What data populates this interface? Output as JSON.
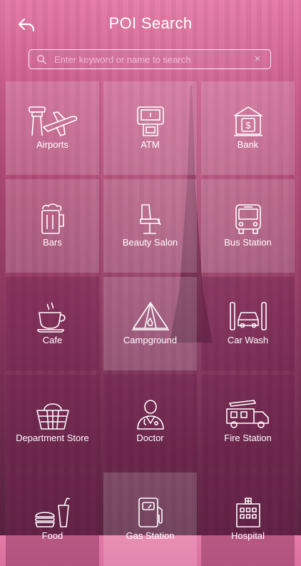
{
  "header": {
    "title": "POI Search",
    "back_icon": "back-arrow-icon"
  },
  "search": {
    "placeholder": "Enter keyword or name to search",
    "value": ""
  },
  "categories": [
    {
      "label": "Airports",
      "icon": "airport-icon"
    },
    {
      "label": "ATM",
      "icon": "atm-icon"
    },
    {
      "label": "Bank",
      "icon": "bank-icon"
    },
    {
      "label": "Bars",
      "icon": "beer-mug-icon"
    },
    {
      "label": "Beauty Salon",
      "icon": "salon-chair-icon"
    },
    {
      "label": "Bus Station",
      "icon": "bus-icon"
    },
    {
      "label": "Cafe",
      "icon": "coffee-cup-icon"
    },
    {
      "label": "Campground",
      "icon": "tent-icon"
    },
    {
      "label": "Car Wash",
      "icon": "car-wash-icon"
    },
    {
      "label": "Department Store",
      "icon": "basket-icon"
    },
    {
      "label": "Doctor",
      "icon": "doctor-icon"
    },
    {
      "label": "Fire Station",
      "icon": "fire-truck-icon"
    },
    {
      "label": "Food",
      "icon": "burger-drink-icon"
    },
    {
      "label": "Gas Station",
      "icon": "gas-pump-icon"
    },
    {
      "label": "Hospital",
      "icon": "hospital-icon"
    }
  ]
}
